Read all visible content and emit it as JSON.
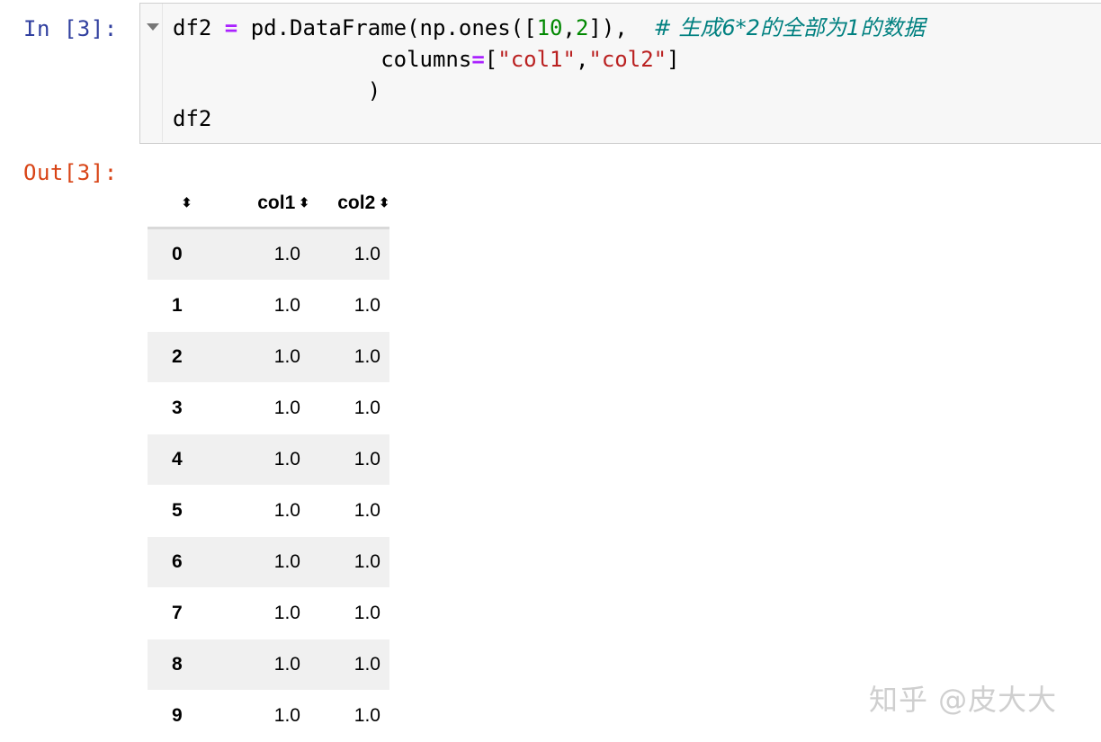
{
  "input_prompt": "In [3]:",
  "output_prompt": "Out[3]:",
  "code": {
    "line1": {
      "a": "df2 ",
      "op": "=",
      "b": " pd.DataFrame(np.ones([",
      "n1": "10",
      "c": ",",
      "n2": "2",
      "d": "]),  ",
      "comment": "# 生成6*2的全部为1的数据"
    },
    "line2": {
      "indent": "                columns",
      "op": "=",
      "b": "[",
      "s1": "\"col1\"",
      "c": ",",
      "s2": "\"col2\"",
      "d": "]"
    },
    "line3": "               )",
    "line4": "df2"
  },
  "table": {
    "headers": [
      "",
      "col1",
      "col2"
    ],
    "rows": [
      [
        "0",
        "1.0",
        "1.0"
      ],
      [
        "1",
        "1.0",
        "1.0"
      ],
      [
        "2",
        "1.0",
        "1.0"
      ],
      [
        "3",
        "1.0",
        "1.0"
      ],
      [
        "4",
        "1.0",
        "1.0"
      ],
      [
        "5",
        "1.0",
        "1.0"
      ],
      [
        "6",
        "1.0",
        "1.0"
      ],
      [
        "7",
        "1.0",
        "1.0"
      ],
      [
        "8",
        "1.0",
        "1.0"
      ],
      [
        "9",
        "1.0",
        "1.0"
      ]
    ]
  },
  "sort_icon": "sort-updown-icon",
  "watermark": "知乎 @皮大大"
}
